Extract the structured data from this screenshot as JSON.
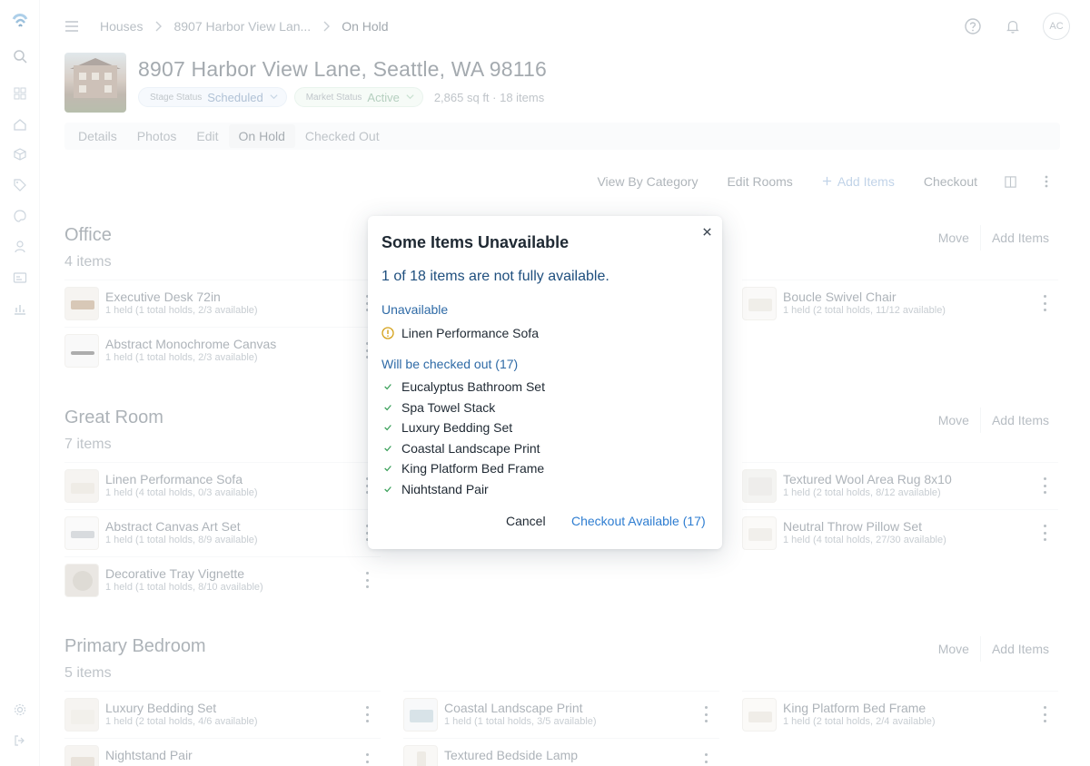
{
  "header": {
    "breadcrumb": [
      "Houses",
      "8907 Harbor View Lan...",
      "On Hold"
    ],
    "avatar_initials": "AC"
  },
  "property": {
    "title": "8907 Harbor View Lane, Seattle, WA 98116",
    "stage_label": "Stage Status",
    "stage_value": "Scheduled",
    "market_label": "Market Status",
    "market_value": "Active",
    "meta": "2,865 sq ft · 18 items",
    "tabs": [
      "Details",
      "Photos",
      "Edit",
      "On Hold",
      "Checked Out"
    ],
    "active_tab": "On Hold"
  },
  "actions": {
    "view_by_category": "View By Category",
    "edit_rooms": "Edit Rooms",
    "add_items": "Add Items",
    "checkout": "Checkout"
  },
  "room_actions": {
    "move": "Move",
    "add_items": "Add Items"
  },
  "rooms": [
    {
      "title": "Office",
      "count": "4 items",
      "items": [
        {
          "name": "Executive Desk 72in",
          "sub": "1 held (1 total holds, 2/3 available)"
        },
        {
          "name": "Abstract Monochrome Canvas",
          "sub": "1 held (1 total holds, 2/3 available)"
        },
        {
          "name": "Boucle Swivel Chair",
          "sub": "1 held (2 total holds, 11/12 available)"
        }
      ]
    },
    {
      "title": "Great Room",
      "count": "7 items",
      "items": [
        {
          "name": "Linen Performance Sofa",
          "sub": "1 held (4 total holds, 0/3 available)"
        },
        {
          "name": "Abstract Canvas Art Set",
          "sub": "1 held (1 total holds, 8/9 available)"
        },
        {
          "name": "Decorative Tray Vignette",
          "sub": "1 held (1 total holds, 8/10 available)"
        },
        {
          "name": "Textured Wool Area Rug 8x10",
          "sub": "1 held (2 total holds, 8/12 available)"
        },
        {
          "name": "Neutral Throw Pillow Set",
          "sub": "1 held (4 total holds, 27/30 available)"
        }
      ]
    },
    {
      "title": "Primary Bedroom",
      "count": "5 items",
      "items": [
        {
          "name": "Luxury Bedding Set",
          "sub": "1 held (2 total holds, 4/6 available)"
        },
        {
          "name": "Coastal Landscape Print",
          "sub": "1 held (1 total holds, 3/5 available)"
        },
        {
          "name": "King Platform Bed Frame",
          "sub": "1 held (2 total holds, 2/4 available)"
        },
        {
          "name": "Nightstand Pair",
          "sub": ""
        },
        {
          "name": "Textured Bedside Lamp",
          "sub": ""
        }
      ]
    }
  ],
  "modal": {
    "title": "Some Items Unavailable",
    "summary": "1 of 18 items are not fully available.",
    "unavailable_title": "Unavailable",
    "unavailable_items": [
      "Linen Performance Sofa"
    ],
    "checked_out_title": "Will be checked out (17)",
    "checked_out_items": [
      "Eucalyptus Bathroom Set",
      "Spa Towel Stack",
      "Luxury Bedding Set",
      "Coastal Landscape Print",
      "King Platform Bed Frame",
      "Nightstand Pair"
    ],
    "cancel_label": "Cancel",
    "checkout_label": "Checkout Available (17)"
  },
  "icons": {
    "sidebar": [
      "logo-icon",
      "search-icon",
      "dashboard-icon",
      "home-icon",
      "box-icon",
      "tag-icon",
      "palette-icon",
      "user-icon",
      "id-card-icon",
      "chart-icon",
      "settings-icon",
      "logout-icon"
    ]
  },
  "colors": {
    "accent": "#2e7dd1",
    "title": "#1f2933",
    "warning": "#d4a017",
    "success": "#3aa05a"
  }
}
